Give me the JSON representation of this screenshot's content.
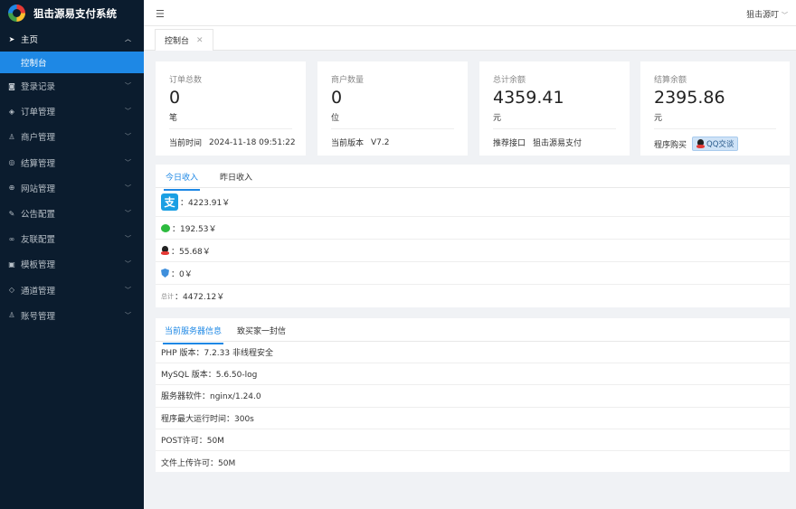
{
  "app": {
    "title": "狙击源易支付系统"
  },
  "sidebar": {
    "main": "主页",
    "active_sub": "控制台",
    "items": [
      {
        "label": "登录记录",
        "icon": "camera-icon",
        "glyph": "◙"
      },
      {
        "label": "订单管理",
        "icon": "box-icon",
        "glyph": "◈"
      },
      {
        "label": "商户管理",
        "icon": "user-icon",
        "glyph": "♙"
      },
      {
        "label": "结算管理",
        "icon": "target-icon",
        "glyph": "◎"
      },
      {
        "label": "网站管理",
        "icon": "globe-icon",
        "glyph": "⊕"
      },
      {
        "label": "公告配置",
        "icon": "pen-icon",
        "glyph": "✎"
      },
      {
        "label": "友联配置",
        "icon": "link-icon",
        "glyph": "∞"
      },
      {
        "label": "模板管理",
        "icon": "template-icon",
        "glyph": "▣"
      },
      {
        "label": "通道管理",
        "icon": "shield-icon",
        "glyph": "◇"
      },
      {
        "label": "账号管理",
        "icon": "account-icon",
        "glyph": "♙"
      }
    ]
  },
  "header": {
    "user": "狙击源叮"
  },
  "tabs": {
    "active": "控制台"
  },
  "cards": [
    {
      "label": "订单总数",
      "value": "0",
      "unit": "笔",
      "foot_label": "当前时间",
      "foot_value": "2024-11-18 09:51:22"
    },
    {
      "label": "商户数量",
      "value": "0",
      "unit": "位",
      "foot_label": "当前版本",
      "foot_value": "V7.2"
    },
    {
      "label": "总计余额",
      "value": "4359.41",
      "unit": "元",
      "foot_label": "推荐接口",
      "foot_value": "狙击源易支付"
    },
    {
      "label": "结算余额",
      "value": "2395.86",
      "unit": "元",
      "foot_label": "程序购买",
      "foot_value": "QQ交谈"
    }
  ],
  "income": {
    "tabs": [
      "今日收入",
      "昨日收入"
    ],
    "rows": [
      {
        "icon": "alipay-icon",
        "text": "：4223.91￥"
      },
      {
        "icon": "wechat-icon",
        "text": "：192.53￥"
      },
      {
        "icon": "qq-icon",
        "text": "：55.68￥"
      },
      {
        "icon": "shield-icon",
        "text": "：0￥"
      },
      {
        "icon": "total-icon",
        "prefix": "总计",
        "text": "：4472.12￥"
      }
    ]
  },
  "server": {
    "tabs": [
      "当前服务器信息",
      "致买家一封信"
    ],
    "rows": [
      "PHP 版本：7.2.33 非线程安全",
      "MySQL 版本：5.6.50-log",
      "服务器软件：nginx/1.24.0",
      "程序最大运行时间：300s",
      "POST许可：50M",
      "文件上传许可：50M"
    ]
  }
}
